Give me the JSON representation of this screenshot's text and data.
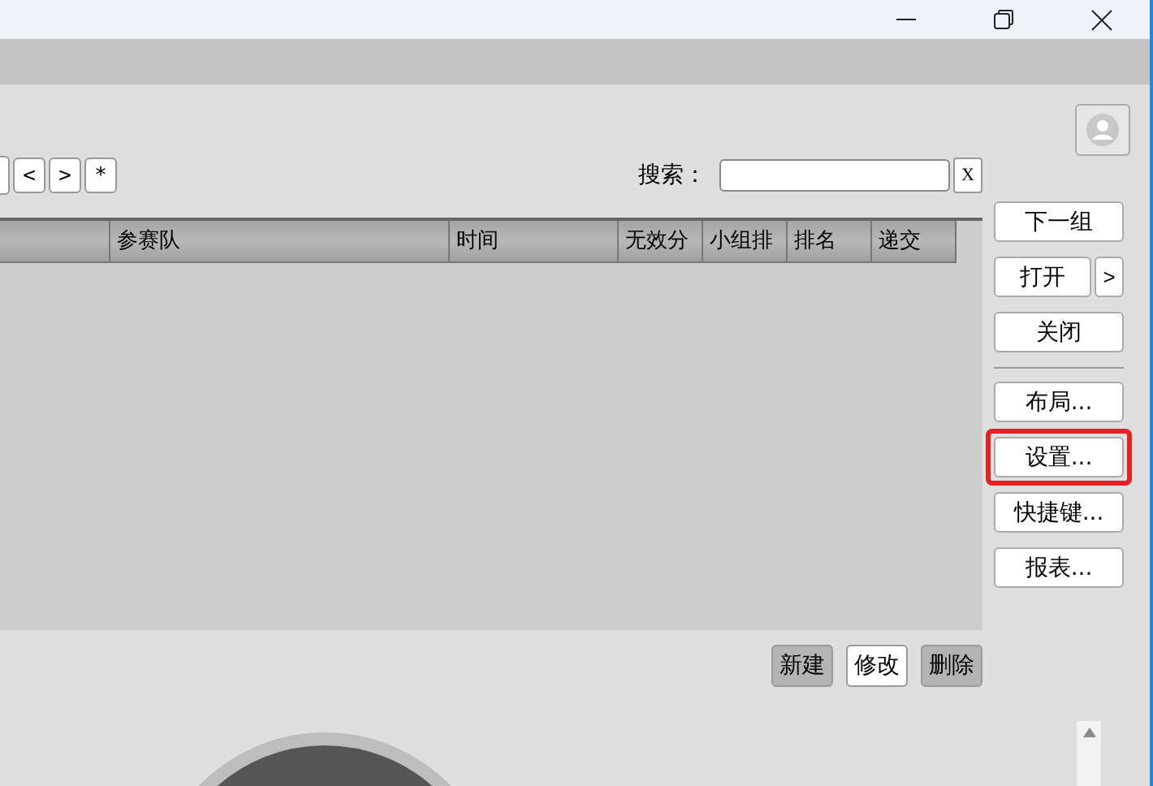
{
  "nav_buttons": [
    {
      "label": "<"
    },
    {
      "label": ">"
    },
    {
      "label": "*"
    }
  ],
  "search": {
    "label": "搜索：",
    "clear": "X"
  },
  "table": {
    "columns": [
      "参赛队",
      "时间",
      "无效分",
      "小组排",
      "排名",
      "递交"
    ]
  },
  "side_buttons": [
    {
      "kind": "button",
      "label": "下一组",
      "highlighted": false
    },
    {
      "kind": "split",
      "label": "打开",
      "arrow": ">"
    },
    {
      "kind": "button",
      "label": "关闭",
      "highlighted": false
    },
    {
      "kind": "divider"
    },
    {
      "kind": "button",
      "label": "布局...",
      "highlighted": false
    },
    {
      "kind": "button",
      "label": "设置...",
      "highlighted": true
    },
    {
      "kind": "button",
      "label": "快捷键...",
      "highlighted": false
    },
    {
      "kind": "button",
      "label": "报表...",
      "highlighted": false
    }
  ],
  "actions": [
    {
      "label": "新建",
      "selected": false
    },
    {
      "label": "修改",
      "selected": true
    },
    {
      "label": "删除",
      "selected": false
    }
  ]
}
